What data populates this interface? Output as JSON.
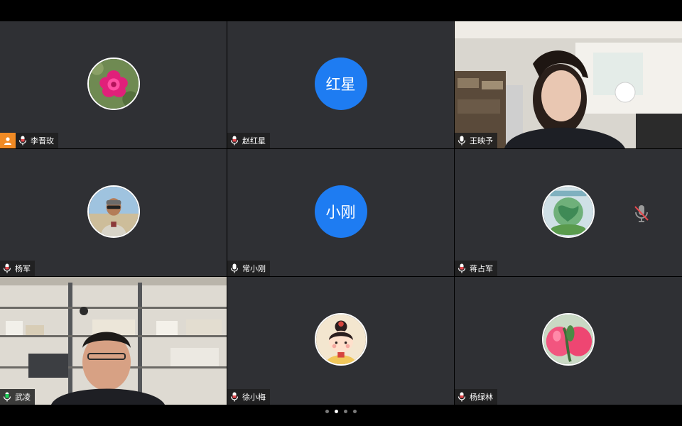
{
  "participants": [
    {
      "name": "李晋玫",
      "avatar": "flower-photo",
      "host": true
    },
    {
      "name": "赵红星",
      "avatar_text": "红星"
    },
    {
      "name": "王映予",
      "video": true
    },
    {
      "name": "杨军",
      "avatar": "man-sunglasses-photo"
    },
    {
      "name": "常小刚",
      "avatar_text": "小刚"
    },
    {
      "name": "蒋占军",
      "avatar": "globe-photo",
      "muted": true
    },
    {
      "name": "武凌",
      "video": true,
      "active_speaker": true
    },
    {
      "name": "徐小梅",
      "avatar": "cartoon-girl"
    },
    {
      "name": "杨绿林",
      "avatar": "peach-photo"
    }
  ],
  "pager": {
    "pages": 4,
    "current": 2
  },
  "colors": {
    "tile_bg": "#2f3034",
    "avatar_blue": "#1e7cf2",
    "host_badge": "#f08a24",
    "active_speaker": "#1fd15c",
    "mic_muted": "#e5484d"
  }
}
